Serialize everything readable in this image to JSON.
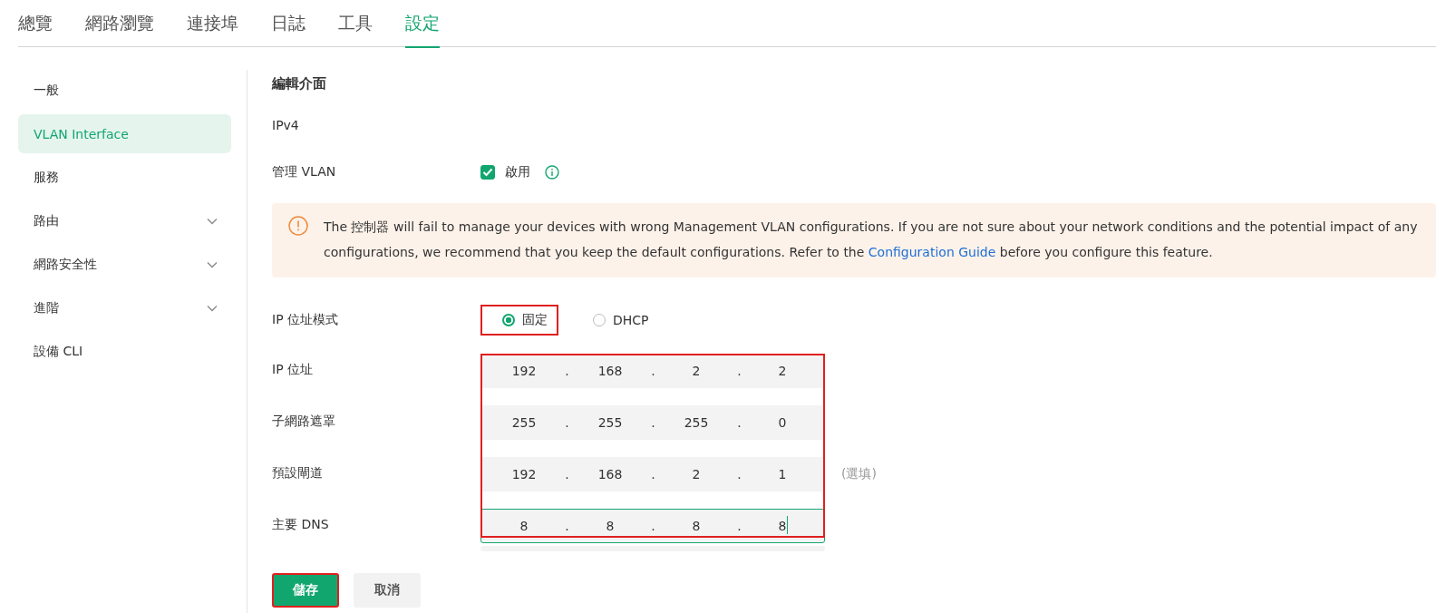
{
  "tabs": [
    {
      "label": "總覽",
      "selected": false
    },
    {
      "label": "網路瀏覽",
      "selected": false
    },
    {
      "label": "連接埠",
      "selected": false
    },
    {
      "label": "日誌",
      "selected": false
    },
    {
      "label": "工具",
      "selected": false
    },
    {
      "label": "設定",
      "selected": true
    }
  ],
  "sidebar": {
    "items": [
      {
        "label": "一般",
        "selected": false,
        "expandable": false
      },
      {
        "label": "VLAN Interface",
        "selected": true,
        "expandable": false
      },
      {
        "label": "服務",
        "selected": false,
        "expandable": false
      },
      {
        "label": "路由",
        "selected": false,
        "expandable": true
      },
      {
        "label": "網路安全性",
        "selected": false,
        "expandable": true
      },
      {
        "label": "進階",
        "selected": false,
        "expandable": true
      },
      {
        "label": "設備 CLI",
        "selected": false,
        "expandable": false
      }
    ]
  },
  "form": {
    "title": "編輯介面",
    "section": "IPv4",
    "management_vlan": {
      "label": "管理 VLAN",
      "checkbox_label": "啟用",
      "checked": true
    },
    "warning": {
      "text_before": "The 控制器 will fail to manage your devices with wrong Management VLAN configurations. If you are not sure about your network conditions and the potential impact of any configurations, we recommend that you keep the default configurations. Refer to the ",
      "link": "Configuration Guide",
      "text_after": " before you configure this feature."
    },
    "ip_mode": {
      "label": "IP 位址模式",
      "options": [
        {
          "label": "固定",
          "selected": true,
          "highlighted": true
        },
        {
          "label": "DHCP",
          "selected": false,
          "highlighted": false
        }
      ]
    },
    "ip_fields": {
      "highlighted": true,
      "separator": ".",
      "rows": [
        {
          "label": "IP 位址",
          "octets": [
            "192",
            "168",
            "2",
            "2"
          ],
          "focused": false
        },
        {
          "label": "子網路遮罩",
          "octets": [
            "255",
            "255",
            "255",
            "0"
          ],
          "focused": false
        },
        {
          "label": "預設閘道",
          "octets": [
            "192",
            "168",
            "2",
            "1"
          ],
          "focused": false,
          "note": "(選填)"
        },
        {
          "label": "主要 DNS",
          "octets": [
            "8",
            "8",
            "8",
            "8"
          ],
          "focused": true
        }
      ]
    },
    "buttons": [
      {
        "label": "儲存",
        "kind": "primary",
        "highlighted": true
      },
      {
        "label": "取消",
        "kind": "secondary",
        "highlighted": false
      }
    ]
  }
}
